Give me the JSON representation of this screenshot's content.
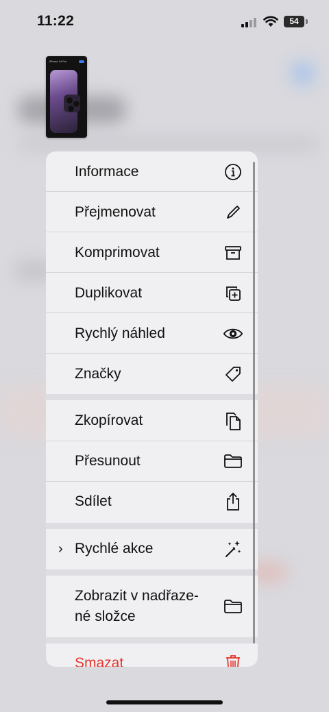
{
  "status_bar": {
    "time": "11:22",
    "battery": "54"
  },
  "thumbnail": {
    "title": "iPhone 14 Pro"
  },
  "menu": {
    "items": [
      {
        "label": "Informace",
        "icon": "info-icon"
      },
      {
        "label": "Přejmenovat",
        "icon": "pencil-icon"
      },
      {
        "label": "Komprimovat",
        "icon": "archive-box-icon"
      },
      {
        "label": "Duplikovat",
        "icon": "plus-square-on-square-icon"
      },
      {
        "label": "Rychlý náhled",
        "icon": "eye-icon"
      },
      {
        "label": "Značky",
        "icon": "tag-icon"
      },
      {
        "label": "Zkopírovat",
        "icon": "copy-documents-icon"
      },
      {
        "label": "Přesunout",
        "icon": "folder-icon"
      },
      {
        "label": "Sdílet",
        "icon": "share-icon"
      },
      {
        "label": "Rychlé akce",
        "icon": "sparkles-icon"
      },
      {
        "label": "Zobrazit v nadřaze-",
        "label_line2": "né složce",
        "icon": "folder-icon"
      },
      {
        "label": "Smazat",
        "icon": "trash-icon"
      }
    ]
  },
  "colors": {
    "destructive": "#e5332a",
    "menu_bg": "#f0f0f2",
    "text": "#111111"
  }
}
